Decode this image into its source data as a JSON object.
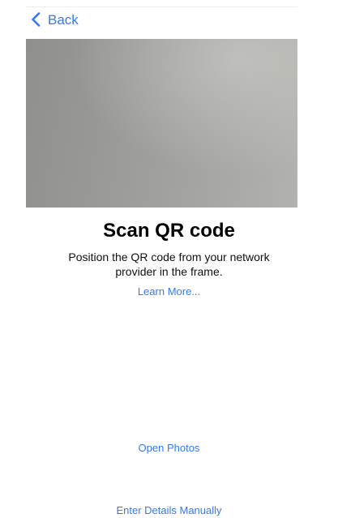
{
  "nav": {
    "back_label": "Back"
  },
  "camera": {
    "description": ""
  },
  "main": {
    "title": "Scan QR code",
    "description": "Position the QR code from your network provider in the frame.",
    "learn_more": "Learn More..."
  },
  "actions": {
    "open_photos": "Open Photos",
    "enter_manually": "Enter Details Manually"
  },
  "colors": {
    "accent": "#3478f6",
    "background": "#ffffff",
    "text": "#000000"
  }
}
